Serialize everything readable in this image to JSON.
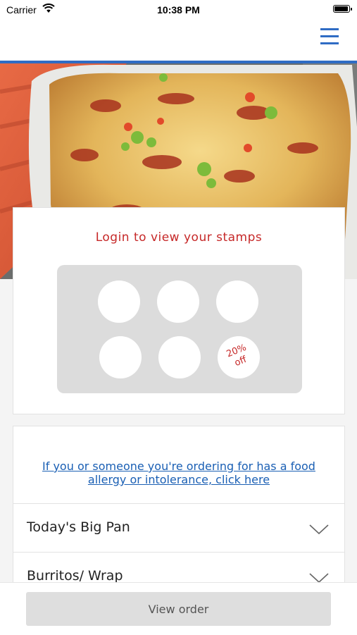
{
  "status_bar": {
    "carrier": "Carrier",
    "time": "10:38 PM",
    "battery_level": 1.0
  },
  "nav": {
    "menu_icon": "hamburger-menu-icon",
    "accent_color": "#2f6cc4"
  },
  "hero": {
    "image": "enchiladas-dish-photo"
  },
  "stamps": {
    "title": "Login to view your stamps",
    "total_slots": 6,
    "reward_text": "20% off",
    "title_color": "#c62828"
  },
  "menu": {
    "allergy_link": "If you or someone you're ordering for has a food allergy or intolerance, click here",
    "link_color": "#1a5fb4",
    "categories": [
      {
        "label": "Today's Big Pan",
        "icon": "chevron-down-icon"
      },
      {
        "label": "Burritos/ Wrap",
        "icon": "chevron-down-icon"
      }
    ]
  },
  "footer": {
    "view_order_label": "View order"
  }
}
